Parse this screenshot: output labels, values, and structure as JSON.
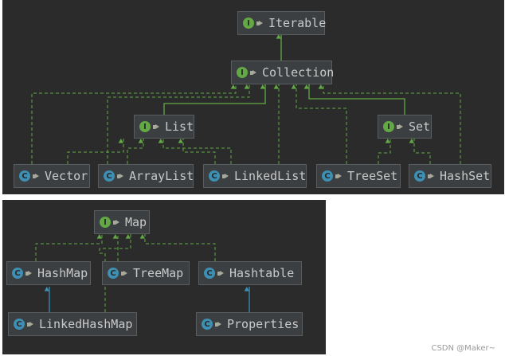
{
  "colors": {
    "background": "#2b2b2b",
    "node_fill": "#3c3f41",
    "node_border": "#5a5d5f",
    "interface_icon": "#62a845",
    "class_icon": "#3d8fb3",
    "implements_edge": "#62a845",
    "extends_edge": "#3d8fb3",
    "text": "#c9c9c9"
  },
  "icons": {
    "interface": "interface-icon",
    "class": "class-icon",
    "visibility": "public-visibility-icon"
  },
  "diagrams": {
    "collection": {
      "iterable": {
        "label": "Iterable",
        "kind": "interface",
        "glyph": "I"
      },
      "collection": {
        "label": "Collection",
        "kind": "interface",
        "glyph": "I"
      },
      "list": {
        "label": "List",
        "kind": "interface",
        "glyph": "I"
      },
      "set": {
        "label": "Set",
        "kind": "interface",
        "glyph": "I"
      },
      "vector": {
        "label": "Vector",
        "kind": "class",
        "glyph": "C"
      },
      "arraylist": {
        "label": "ArrayList",
        "kind": "class",
        "glyph": "C"
      },
      "linkedlist": {
        "label": "LinkedList",
        "kind": "class",
        "glyph": "C"
      },
      "treeset": {
        "label": "TreeSet",
        "kind": "class",
        "glyph": "C"
      },
      "hashset": {
        "label": "HashSet",
        "kind": "class",
        "glyph": "C"
      }
    },
    "map": {
      "map": {
        "label": "Map",
        "kind": "interface",
        "glyph": "I"
      },
      "hashmap": {
        "label": "HashMap",
        "kind": "class",
        "glyph": "C"
      },
      "treemap": {
        "label": "TreeMap",
        "kind": "class",
        "glyph": "C"
      },
      "hashtable": {
        "label": "Hashtable",
        "kind": "class",
        "glyph": "C"
      },
      "linkedhashmap": {
        "label": "LinkedHashMap",
        "kind": "class",
        "glyph": "C"
      },
      "properties": {
        "label": "Properties",
        "kind": "class",
        "glyph": "C"
      }
    }
  },
  "relations": [
    {
      "from": "Collection",
      "to": "Iterable",
      "type": "extends-interface"
    },
    {
      "from": "List",
      "to": "Collection",
      "type": "extends-interface"
    },
    {
      "from": "Set",
      "to": "Collection",
      "type": "extends-interface"
    },
    {
      "from": "Vector",
      "to": "List",
      "type": "implements"
    },
    {
      "from": "ArrayList",
      "to": "List",
      "type": "implements"
    },
    {
      "from": "LinkedList",
      "to": "List",
      "type": "implements"
    },
    {
      "from": "TreeSet",
      "to": "Set",
      "type": "implements"
    },
    {
      "from": "HashSet",
      "to": "Set",
      "type": "implements"
    },
    {
      "from": "Vector",
      "to": "Collection",
      "type": "implements"
    },
    {
      "from": "ArrayList",
      "to": "Collection",
      "type": "implements"
    },
    {
      "from": "LinkedList",
      "to": "Collection",
      "type": "implements"
    },
    {
      "from": "TreeSet",
      "to": "Collection",
      "type": "implements"
    },
    {
      "from": "HashSet",
      "to": "Collection",
      "type": "implements"
    },
    {
      "from": "HashMap",
      "to": "Map",
      "type": "implements"
    },
    {
      "from": "TreeMap",
      "to": "Map",
      "type": "implements"
    },
    {
      "from": "Hashtable",
      "to": "Map",
      "type": "implements"
    },
    {
      "from": "LinkedHashMap",
      "to": "Map",
      "type": "implements"
    },
    {
      "from": "LinkedHashMap",
      "to": "HashMap",
      "type": "extends"
    },
    {
      "from": "Properties",
      "to": "Hashtable",
      "type": "extends"
    }
  ],
  "watermark": "CSDN @Maker~"
}
